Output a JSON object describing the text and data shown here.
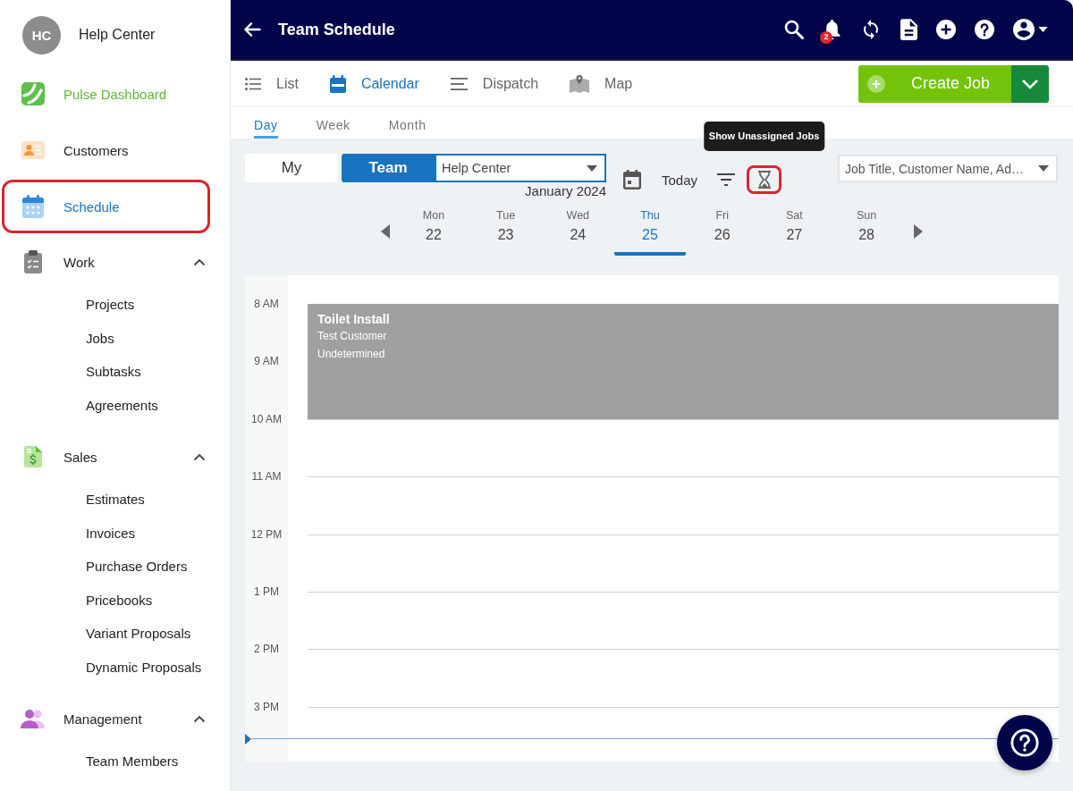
{
  "sidebar": {
    "account": {
      "initials": "HC",
      "name": "Help Center"
    },
    "items": [
      {
        "kind": "featured",
        "label": "Pulse Dashboard",
        "selected": false,
        "highlighted": false
      },
      {
        "kind": "link",
        "label": "Customers",
        "selected": false,
        "highlighted": false
      },
      {
        "kind": "link",
        "label": "Schedule",
        "selected": true,
        "highlighted": true
      },
      {
        "kind": "group",
        "label": "Work",
        "selected": false,
        "highlighted": false,
        "expanded": true,
        "children": [
          {
            "label": "Projects",
            "selected": false
          },
          {
            "label": "Jobs",
            "selected": false
          },
          {
            "label": "Subtasks",
            "selected": false
          },
          {
            "label": "Agreements",
            "selected": false
          }
        ]
      },
      {
        "kind": "group",
        "label": "Sales",
        "selected": false,
        "highlighted": false,
        "expanded": true,
        "children": [
          {
            "label": "Estimates",
            "selected": false
          },
          {
            "label": "Invoices",
            "selected": false
          },
          {
            "label": "Purchase Orders",
            "selected": false
          },
          {
            "label": "Pricebooks",
            "selected": false
          },
          {
            "label": "Variant Proposals",
            "selected": false
          },
          {
            "label": "Dynamic Proposals",
            "selected": false
          }
        ]
      },
      {
        "kind": "group",
        "label": "Management",
        "selected": false,
        "highlighted": false,
        "expanded": true,
        "children": [
          {
            "label": "Team Members",
            "selected": false
          }
        ]
      }
    ]
  },
  "header": {
    "title": "Team Schedule",
    "notifications": "2"
  },
  "views": [
    {
      "label": "List",
      "selected": false
    },
    {
      "label": "Calendar",
      "selected": true
    },
    {
      "label": "Dispatch",
      "selected": false
    },
    {
      "label": "Map",
      "selected": false
    }
  ],
  "create_job": {
    "label": "Create Job"
  },
  "ranges": [
    {
      "label": "Day",
      "selected": true
    },
    {
      "label": "Week",
      "selected": false
    },
    {
      "label": "Month",
      "selected": false
    }
  ],
  "toolbar": {
    "scope": [
      {
        "label": "My",
        "selected": false
      },
      {
        "label": "Team",
        "selected": true
      }
    ],
    "team_select": {
      "value": "Help Center"
    },
    "month": "January 2024",
    "today": "Today",
    "unassigned": {
      "highlighted": true,
      "tooltip": "Show Unassigned Jobs"
    },
    "search": {
      "placeholder": "Job Title, Customer Name, Ad…"
    }
  },
  "days": [
    {
      "weekday": "Mon",
      "date": "22",
      "selected": false
    },
    {
      "weekday": "Tue",
      "date": "23",
      "selected": false
    },
    {
      "weekday": "Wed",
      "date": "24",
      "selected": false
    },
    {
      "weekday": "Thu",
      "date": "25",
      "selected": true
    },
    {
      "weekday": "Fri",
      "date": "26",
      "selected": false
    },
    {
      "weekday": "Sat",
      "date": "27",
      "selected": false
    },
    {
      "weekday": "Sun",
      "date": "28",
      "selected": false
    }
  ],
  "calendar": {
    "hours": [
      {
        "label": "8 AM",
        "booked": true,
        "current": false
      },
      {
        "label": "9 AM",
        "booked": true,
        "current": false
      },
      {
        "label": "10 AM",
        "booked": false,
        "current": false
      },
      {
        "label": "11 AM",
        "booked": false,
        "current": false
      },
      {
        "label": "12 PM",
        "booked": false,
        "current": false
      },
      {
        "label": "1 PM",
        "booked": false,
        "current": false
      },
      {
        "label": "2 PM",
        "booked": false,
        "current": false
      },
      {
        "label": "3 PM",
        "booked": false,
        "current": true
      }
    ],
    "event": {
      "title": "Toilet Install",
      "customer": "Test Customer",
      "status": "Undetermined"
    }
  }
}
